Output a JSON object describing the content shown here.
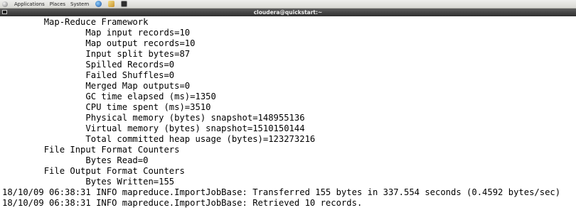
{
  "panel": {
    "menu": [
      "Applications",
      "Places",
      "System"
    ],
    "icons": [
      "gnome-foot-icon",
      "web-browser-icon",
      "text-editor-icon",
      "terminal-icon"
    ]
  },
  "window": {
    "title": "cloudera@quickstart:~"
  },
  "terminal": {
    "lines": [
      "        Map-Reduce Framework",
      "                Map input records=10",
      "                Map output records=10",
      "                Input split bytes=87",
      "                Spilled Records=0",
      "                Failed Shuffles=0",
      "                Merged Map outputs=0",
      "                GC time elapsed (ms)=1350",
      "                CPU time spent (ms)=3510",
      "                Physical memory (bytes) snapshot=148955136",
      "                Virtual memory (bytes) snapshot=1510150144",
      "                Total committed heap usage (bytes)=123273216",
      "        File Input Format Counters",
      "                Bytes Read=0",
      "        File Output Format Counters",
      "                Bytes Written=155",
      "18/10/09 06:38:31 INFO mapreduce.ImportJobBase: Transferred 155 bytes in 337.554 seconds (0.4592 bytes/sec)",
      "18/10/09 06:38:31 INFO mapreduce.ImportJobBase: Retrieved 10 records."
    ]
  }
}
